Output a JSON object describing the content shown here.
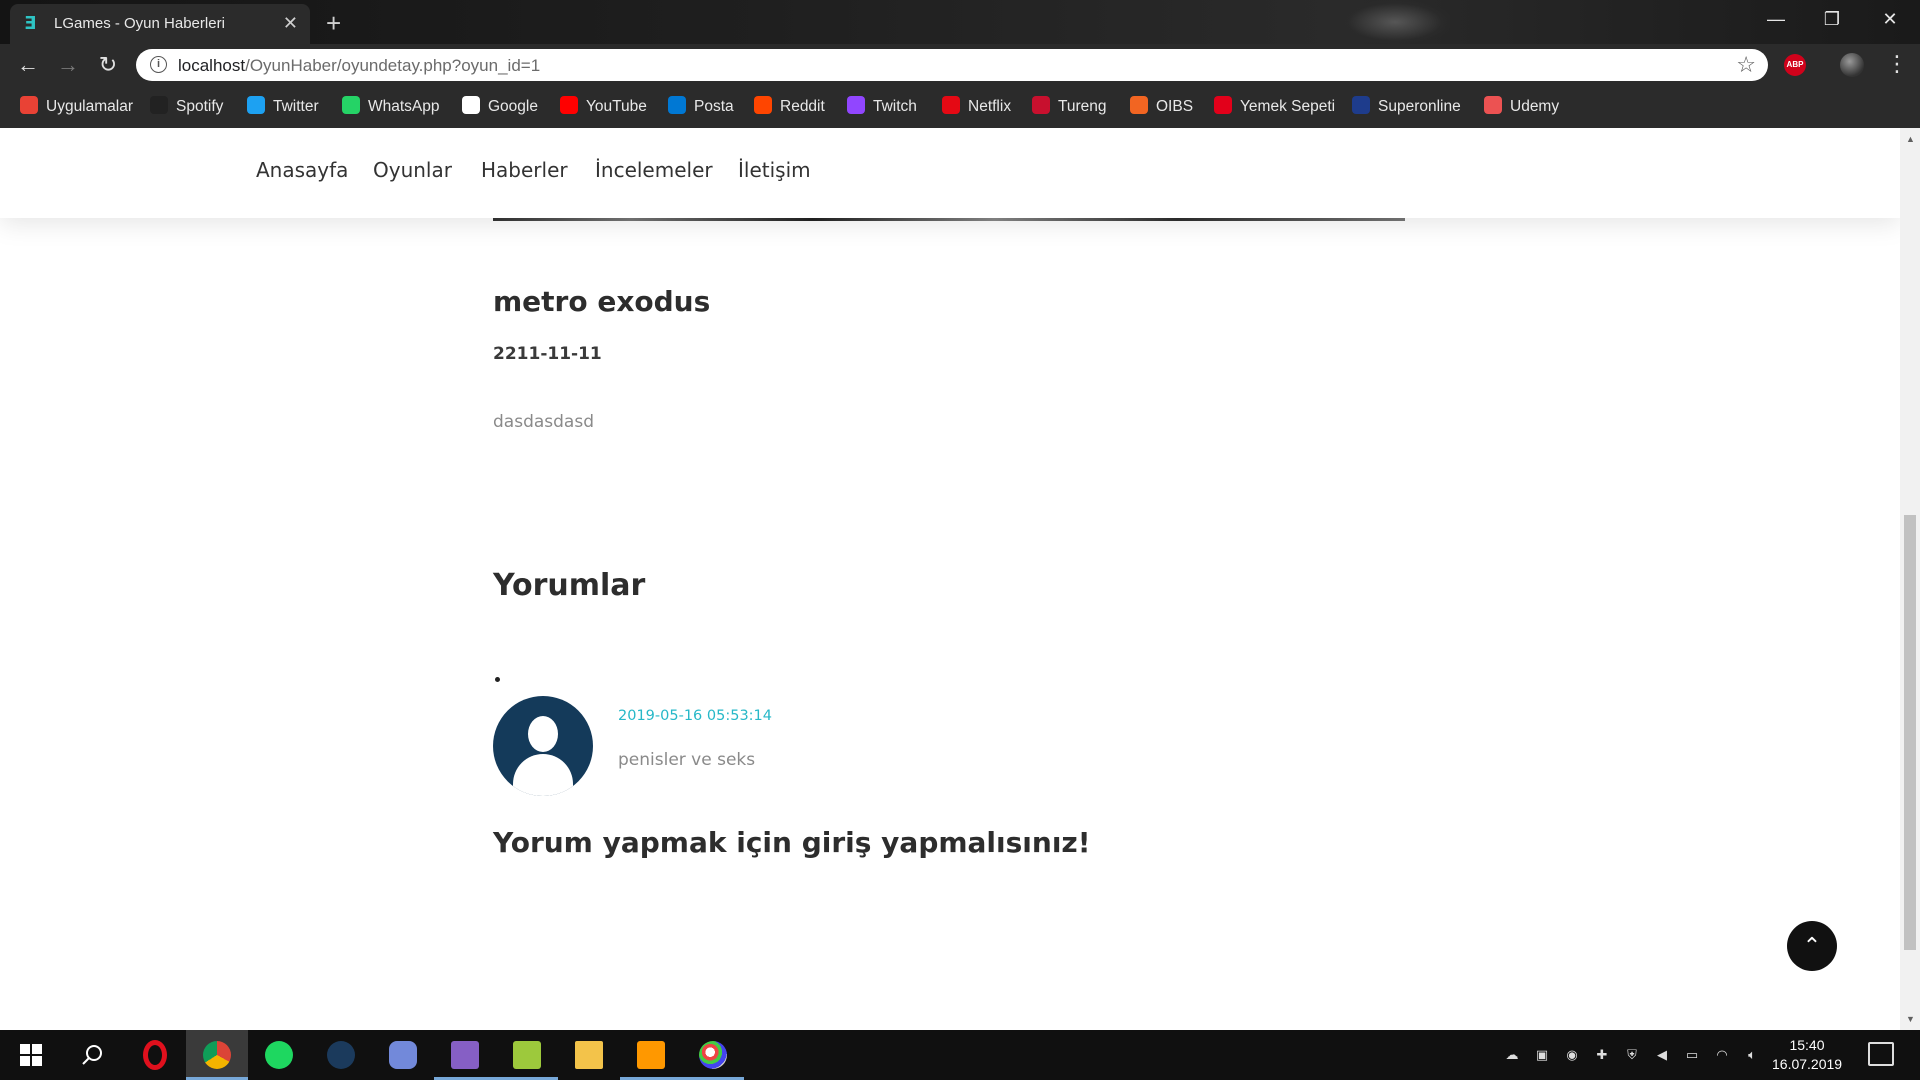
{
  "browser": {
    "tab_title": "LGames - Oyun Haberleri",
    "tab_close": "✕",
    "new_tab": "+",
    "window_controls": {
      "minimize": "—",
      "restore": "❐",
      "close": "✕"
    },
    "url_host": "localhost",
    "url_path": "/OyunHaber/oyundetay.php?oyun_id=1",
    "bookmarks": [
      {
        "label": "Uygulamalar",
        "icon": "apps-grid-icon",
        "color": "#e94235"
      },
      {
        "label": "Spotify",
        "icon": "spotify-icon",
        "color": "#222222"
      },
      {
        "label": "Twitter",
        "icon": "twitter-icon",
        "color": "#1da1f2"
      },
      {
        "label": "WhatsApp",
        "icon": "whatsapp-icon",
        "color": "#25d366"
      },
      {
        "label": "Google",
        "icon": "google-icon",
        "color": "#ffffff"
      },
      {
        "label": "YouTube",
        "icon": "youtube-icon",
        "color": "#ff0000"
      },
      {
        "label": "Posta",
        "icon": "outlook-icon",
        "color": "#0078d4"
      },
      {
        "label": "Reddit",
        "icon": "reddit-icon",
        "color": "#ff4500"
      },
      {
        "label": "Twitch",
        "icon": "twitch-icon",
        "color": "#9146ff"
      },
      {
        "label": "Netflix",
        "icon": "netflix-icon",
        "color": "#e50914"
      },
      {
        "label": "Tureng",
        "icon": "tureng-icon",
        "color": "#c8102e"
      },
      {
        "label": "OIBS",
        "icon": "oibs-icon",
        "color": "#f26522"
      },
      {
        "label": "Yemek Sepeti",
        "icon": "yemeksepeti-icon",
        "color": "#e2001a"
      },
      {
        "label": "Superonline",
        "icon": "superonline-icon",
        "color": "#1e3c8c"
      },
      {
        "label": "Udemy",
        "icon": "udemy-icon",
        "color": "#ec5252"
      }
    ]
  },
  "site": {
    "nav": [
      "Anasayfa",
      "Oyunlar",
      "Haberler",
      "İncelemeler",
      "İletişim"
    ],
    "game": {
      "title": "metro exodus",
      "date": "2211-11-11",
      "description": "dasdasdasd"
    },
    "comments_heading": "Yorumlar",
    "comments": [
      {
        "date": "2019-05-16 05:53:14",
        "text": "penisler ve seks"
      }
    ],
    "login_note": "Yorum yapmak için giriş yapmalısınız!",
    "accent_color": "#27b8c8"
  },
  "taskbar": {
    "apps": [
      "windows-start-icon",
      "search-icon",
      "opera-icon",
      "chrome-icon",
      "spotify-icon",
      "steam-icon",
      "discord-icon",
      "visual-studio-icon",
      "notepad-plus-icon",
      "file-explorer-icon",
      "sublime-text-icon",
      "paint-icon"
    ],
    "time": "15:40",
    "date": "16.07.2019"
  }
}
